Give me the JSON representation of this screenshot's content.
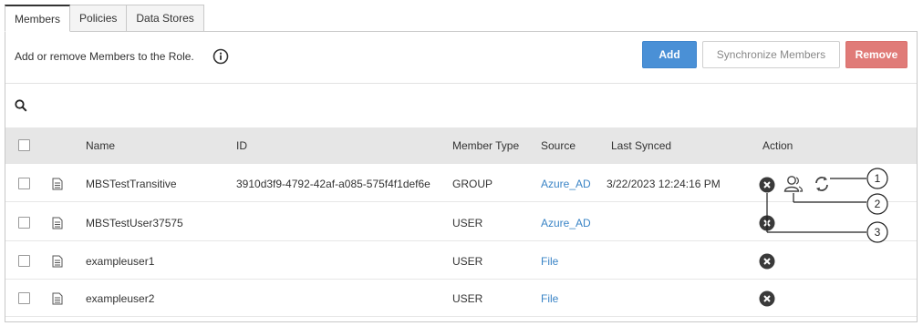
{
  "tabs": [
    {
      "label": "Members",
      "active": true
    },
    {
      "label": "Policies",
      "active": false
    },
    {
      "label": "Data Stores",
      "active": false
    }
  ],
  "header": {
    "description": "Add or remove Members to the Role.",
    "info_icon": "info-circle-icon",
    "add_label": "Add",
    "sync_label": "Synchronize Members",
    "remove_label": "Remove",
    "colors": {
      "add": "#4a90d6",
      "remove": "#e07b78",
      "link": "#3a84c6"
    }
  },
  "search": {
    "icon": "search-icon"
  },
  "table": {
    "columns": {
      "name": "Name",
      "id": "ID",
      "member_type": "Member Type",
      "source": "Source",
      "last_synced": "Last Synced",
      "action": "Action"
    },
    "rows": [
      {
        "name": "MBSTestTransitive",
        "id": "3910d3f9-4792-42af-a085-575f4f1def6e",
        "member_type": "GROUP",
        "source": "Azure_AD",
        "last_synced": "3/22/2023 12:24:16 PM"
      },
      {
        "name": "MBSTestUser37575",
        "id": "",
        "member_type": "USER",
        "source": "Azure_AD",
        "last_synced": ""
      },
      {
        "name": "exampleuser1",
        "id": "",
        "member_type": "USER",
        "source": "File",
        "last_synced": ""
      },
      {
        "name": "exampleuser2",
        "id": "",
        "member_type": "USER",
        "source": "File",
        "last_synced": ""
      }
    ]
  },
  "callouts": [
    "1",
    "2",
    "3"
  ]
}
